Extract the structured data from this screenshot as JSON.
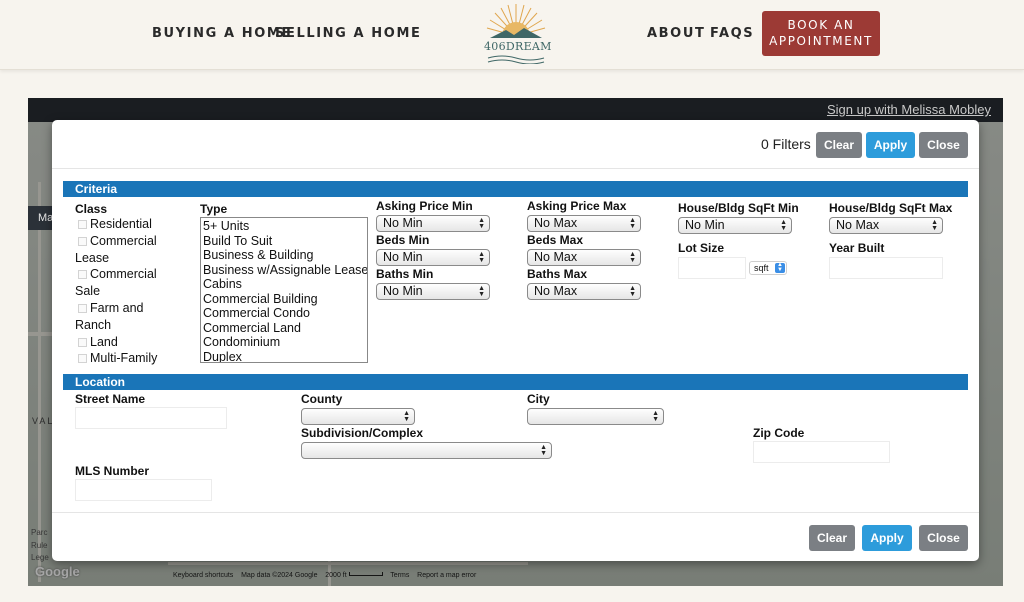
{
  "header": {
    "nav_left": [
      "BUYING A HOME",
      "SELLING A HOME"
    ],
    "logo_text": "406DREAM",
    "nav_right": [
      "ABOUT",
      "FAQS"
    ],
    "book_button": [
      "BOOK AN",
      "APPOINTMENT"
    ],
    "colors": {
      "brand": "#9c3a35",
      "logo": "#3f6766",
      "sun": "#e0a64e"
    }
  },
  "embed": {
    "signup_link": "Sign up with Melissa Mobley",
    "side_tab": "Ma",
    "map_label": "VAL",
    "map_side_labels": [
      "Parc",
      "Rule",
      "Lege"
    ],
    "google": "Google",
    "footer": [
      "Keyboard shortcuts",
      "Map data ©2024 Google",
      "2000 ft",
      "Terms",
      "Report a map error"
    ]
  },
  "modal": {
    "filters_count": "0 Filters",
    "top_buttons": {
      "clear": "Clear",
      "apply": "Apply",
      "close": "Close"
    },
    "bottom_buttons": {
      "clear": "Clear",
      "apply": "Apply",
      "close": "Close"
    },
    "colors": {
      "section": "#1a75b8",
      "apply": "#2d9cdb",
      "neutral": "#7b7f84"
    },
    "criteria": {
      "title": "Criteria",
      "class_label": "Class",
      "class_options": [
        [
          "Residential"
        ],
        [
          "Commercial",
          "Lease"
        ],
        [
          "Commercial",
          "Sale"
        ],
        [
          "Farm and",
          "Ranch"
        ],
        [
          "Land"
        ],
        [
          "Multi-Family"
        ]
      ],
      "type_label": "Type",
      "type_options": [
        "5+ Units",
        "Build To Suit",
        "Business & Building",
        "Business w/Assignable Lease",
        "Cabins",
        "Commercial Building",
        "Commercial Condo",
        "Commercial Land",
        "Condominium",
        "Duplex"
      ],
      "asking_price_min": {
        "label": "Asking Price Min",
        "value": "No Min"
      },
      "asking_price_max": {
        "label": "Asking Price Max",
        "value": "No Max"
      },
      "beds_min": {
        "label": "Beds Min",
        "value": "No Min"
      },
      "beds_max": {
        "label": "Beds Max",
        "value": "No Max"
      },
      "baths_min": {
        "label": "Baths Min",
        "value": "No Min"
      },
      "baths_max": {
        "label": "Baths Max",
        "value": "No Max"
      },
      "sqft_min": {
        "label": "House/Bldg SqFt Min",
        "value": "No Min"
      },
      "sqft_max": {
        "label": "House/Bldg SqFt Max",
        "value": "No Max"
      },
      "lot_size": {
        "label": "Lot Size",
        "unit": "sqft",
        "value": ""
      },
      "year_built": {
        "label": "Year Built",
        "value": ""
      }
    },
    "location": {
      "title": "Location",
      "street_name": {
        "label": "Street Name",
        "value": ""
      },
      "county": {
        "label": "County",
        "value": ""
      },
      "city": {
        "label": "City",
        "value": ""
      },
      "subdivision": {
        "label": "Subdivision/Complex",
        "value": ""
      },
      "zip_code": {
        "label": "Zip Code",
        "value": ""
      },
      "mls_number": {
        "label": "MLS Number",
        "value": ""
      }
    }
  }
}
